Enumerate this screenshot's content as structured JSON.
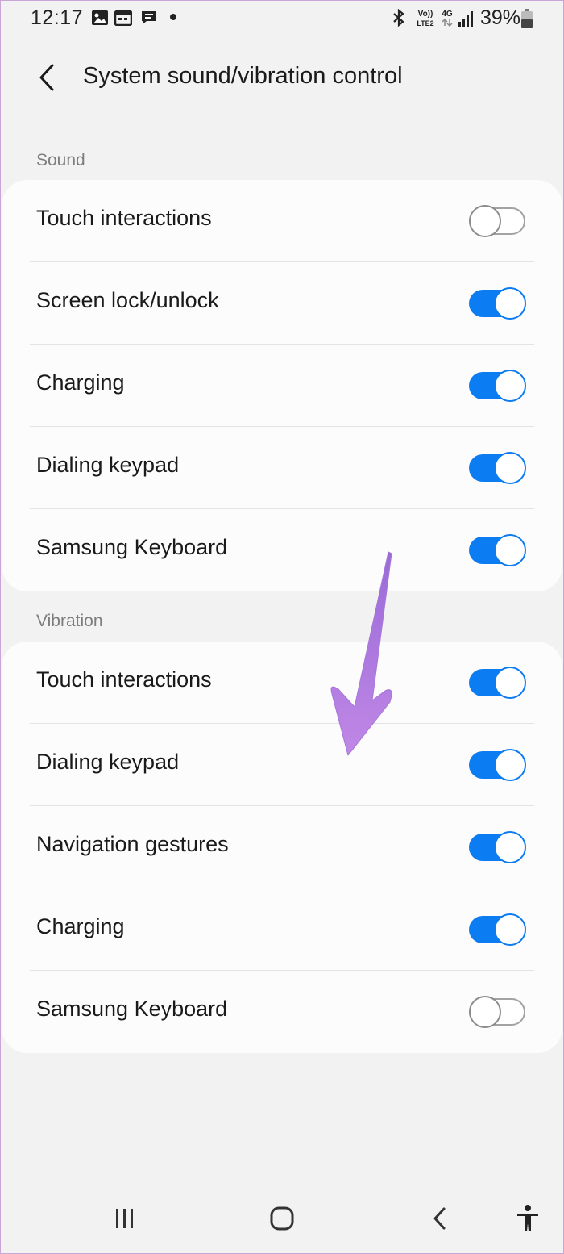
{
  "status_bar": {
    "time": "12:17",
    "battery_percent": "39%",
    "icons": [
      "image-icon",
      "calendar-icon",
      "message-icon",
      "notification-dot",
      "bluetooth-icon",
      "volte-icon",
      "4g-icon",
      "signal-icon",
      "battery-icon"
    ],
    "network_volte": "Vo)) LTE2",
    "network_type": "4G"
  },
  "header": {
    "title": "System sound/vibration control",
    "back_icon": "chevron-left-icon"
  },
  "sound": {
    "label": "Sound",
    "items": [
      {
        "label": "Touch interactions",
        "enabled": false
      },
      {
        "label": "Screen lock/unlock",
        "enabled": true
      },
      {
        "label": "Charging",
        "enabled": true
      },
      {
        "label": "Dialing keypad",
        "enabled": true
      },
      {
        "label": "Samsung Keyboard",
        "enabled": true
      }
    ]
  },
  "vibration": {
    "label": "Vibration",
    "items": [
      {
        "label": "Touch interactions",
        "enabled": true
      },
      {
        "label": "Dialing keypad",
        "enabled": true
      },
      {
        "label": "Navigation gestures",
        "enabled": true
      },
      {
        "label": "Charging",
        "enabled": true
      },
      {
        "label": "Samsung Keyboard",
        "enabled": false
      }
    ]
  },
  "annotation": {
    "icon": "arrow-down-icon",
    "color": "#b57ee0"
  },
  "nav_bar": {
    "icons": [
      "recents-icon",
      "home-icon",
      "back-icon",
      "accessibility-icon"
    ]
  },
  "colors": {
    "accent": "#0c7cf2",
    "background": "#f2f2f2",
    "card": "#fcfcfc"
  }
}
